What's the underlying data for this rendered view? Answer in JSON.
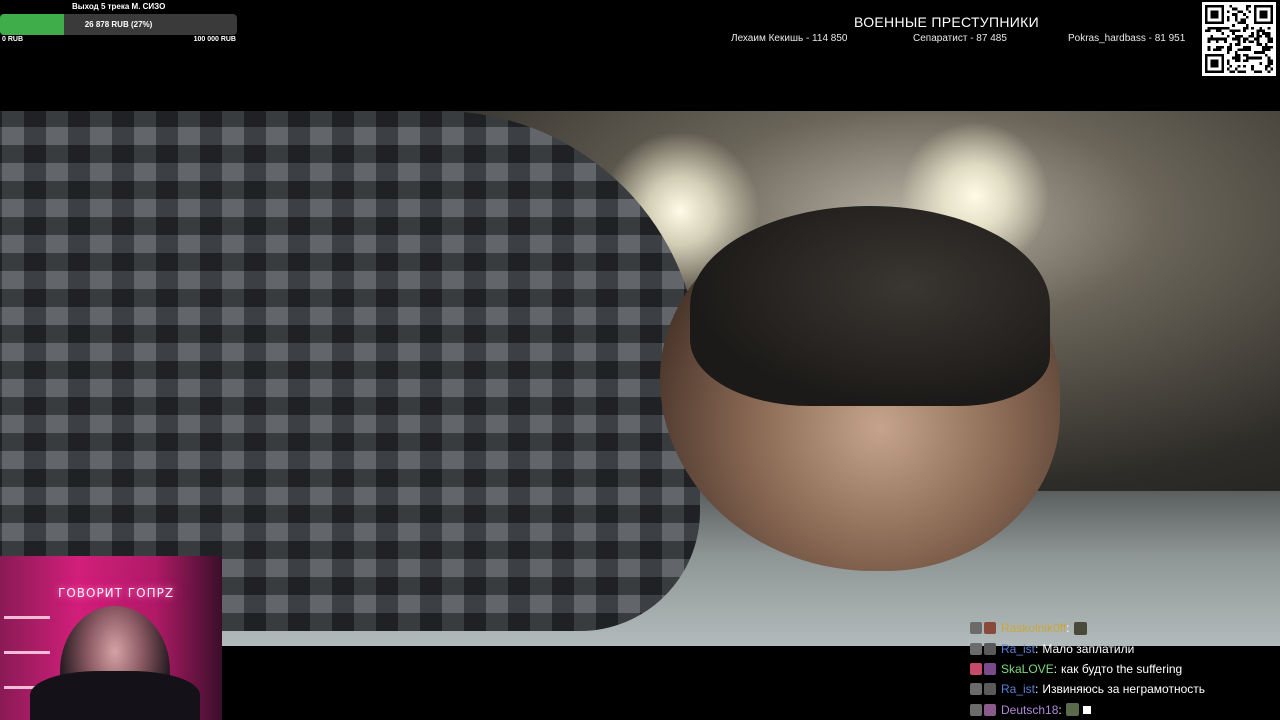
{
  "goal": {
    "title": "Выход 5 трека М. СИЗО",
    "amount_text": "26 878 RUB (27%)",
    "min_label": "0 RUB",
    "max_label": "100 000 RUB",
    "progress_percent": 27,
    "fill_color": "#3fae4a"
  },
  "top_donors": {
    "heading": "ВОЕННЫЕ ПРЕСТУПНИКИ",
    "entries": [
      "Лехаим Кекишь - 114 850",
      "Сепаратист - 87 485",
      "Pokras_hardbass - 81 951"
    ]
  },
  "qr": {
    "icon": "qr-code-icon"
  },
  "video": {
    "description_icon": "video-frame"
  },
  "webcam": {
    "neon_sign": "ГОВОРИТ ГОПРZ"
  },
  "chat": {
    "messages": [
      {
        "user": "Raskolnik0ff",
        "user_color": "#c9a63a",
        "text": "",
        "emote": true,
        "square": false
      },
      {
        "user": "Ra_ist",
        "user_color": "#5b7fd8",
        "text": "Мало заплатили",
        "emote": false,
        "square": false
      },
      {
        "user": "SkaLOVE",
        "user_color": "#7fd87f",
        "text": "как будто the suffering",
        "emote": false,
        "square": false
      },
      {
        "user": "Ra_ist",
        "user_color": "#5b7fd8",
        "text": "Извиняюсь за неграмотность",
        "emote": false,
        "square": false
      },
      {
        "user": "Deutsch18",
        "user_color": "#b08ad8",
        "text": "",
        "emote": true,
        "square": true
      }
    ]
  }
}
